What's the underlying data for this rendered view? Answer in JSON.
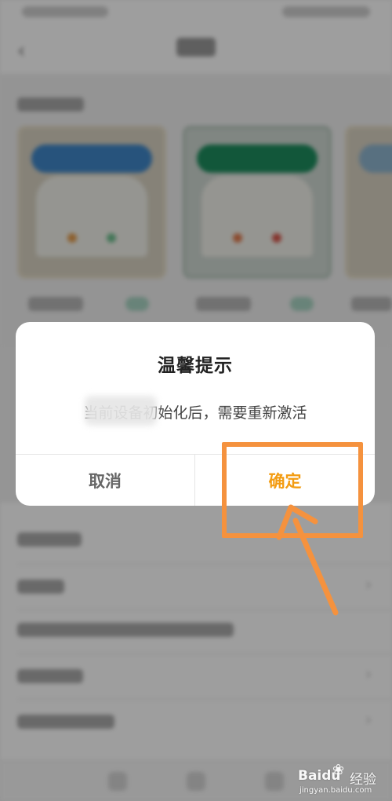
{
  "dialog": {
    "title": "温馨提示",
    "message": "当前设备初始化后，需要重新激活",
    "cancel_label": "取消",
    "confirm_label": "确定"
  },
  "colors": {
    "confirm_text": "#f39c12",
    "highlight": "#f5923e",
    "overlay": "rgba(0,0,0,0.38)"
  },
  "watermark": {
    "brand": "Baidu",
    "suffix": "经验",
    "url": "jingyan.baidu.com"
  }
}
